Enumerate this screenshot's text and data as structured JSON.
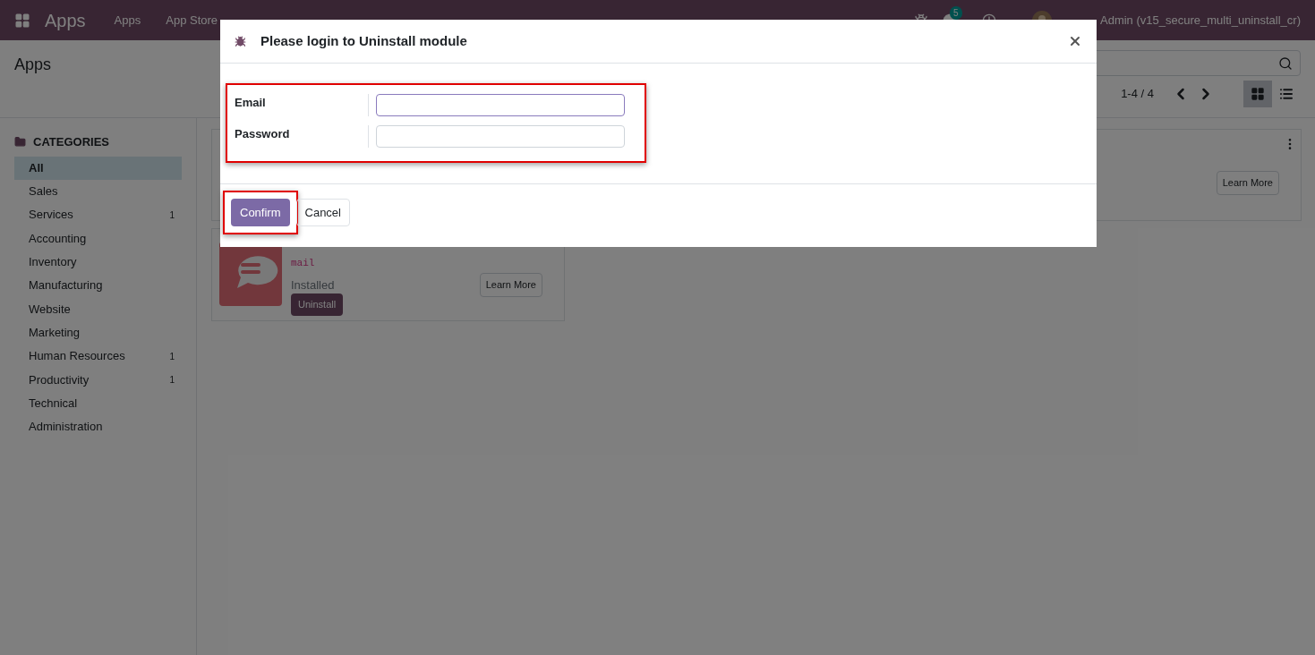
{
  "navbar": {
    "app_name": "Apps",
    "menu": [
      "Apps",
      "App Store"
    ],
    "chat_badge": "5",
    "user": "Admin (v15_secure_multi_uninstall_cr)"
  },
  "control_panel": {
    "title": "Apps",
    "pager": "1-4 / 4",
    "views": [
      {
        "kind": "kanban",
        "selected": true
      },
      {
        "kind": "list",
        "selected": false
      }
    ]
  },
  "sidebar": {
    "heading": "CATEGORIES",
    "items": [
      {
        "label": "All",
        "selected": true
      },
      {
        "label": "Sales",
        "selected": false
      },
      {
        "label": "Services",
        "count": "1",
        "selected": false
      },
      {
        "label": "Accounting",
        "selected": false
      },
      {
        "label": "Inventory",
        "selected": false
      },
      {
        "label": "Manufacturing",
        "selected": false
      },
      {
        "label": "Website",
        "selected": false
      },
      {
        "label": "Marketing",
        "selected": false
      },
      {
        "label": "Human Resources",
        "count": "1",
        "selected": false
      },
      {
        "label": "Productivity",
        "count": "1",
        "selected": false
      },
      {
        "label": "Technical",
        "selected": false
      },
      {
        "label": "Administration",
        "selected": false
      }
    ]
  },
  "cards": [
    {
      "learn_more": "Learn More"
    },
    {
      "technical_name": "mail",
      "status": "Installed",
      "action": "Uninstall",
      "learn_more": "Learn More"
    }
  ],
  "dialog": {
    "title": "Please login to Uninstall module",
    "fields": [
      {
        "label": "Email",
        "focused": true
      },
      {
        "label": "Password",
        "focused": false
      }
    ],
    "buttons": [
      {
        "label": "Confirm",
        "kind": "primary"
      },
      {
        "label": "Cancel",
        "kind": "secondary"
      }
    ]
  }
}
